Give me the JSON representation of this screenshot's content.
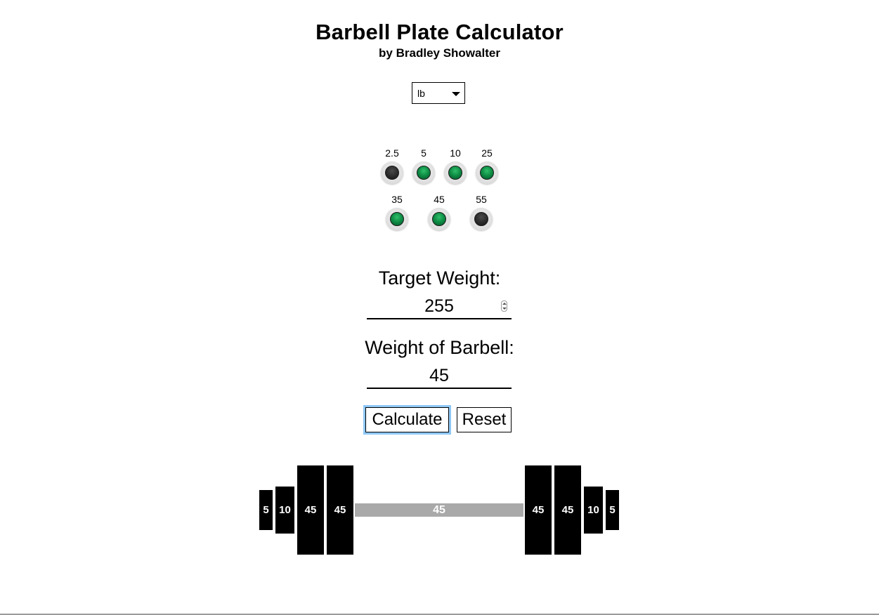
{
  "header": {
    "title": "Barbell Plate Calculator",
    "subtitle": "by Bradley Showalter"
  },
  "unit_select": {
    "selected": "lb"
  },
  "plate_toggles": [
    {
      "label": "2.5",
      "enabled": false
    },
    {
      "label": "5",
      "enabled": true
    },
    {
      "label": "10",
      "enabled": true
    },
    {
      "label": "25",
      "enabled": true
    },
    {
      "label": "35",
      "enabled": true
    },
    {
      "label": "45",
      "enabled": true
    },
    {
      "label": "55",
      "enabled": false
    }
  ],
  "form": {
    "target_label": "Target Weight:",
    "target_value": "255",
    "barbell_label": "Weight of Barbell:",
    "barbell_value": "45",
    "calculate_label": "Calculate",
    "reset_label": "Reset"
  },
  "result": {
    "bar_weight": "45",
    "left_plates": [
      "5",
      "10",
      "45",
      "45"
    ],
    "right_plates": [
      "45",
      "45",
      "10",
      "5"
    ]
  },
  "colors": {
    "led_on": "#0d8a43",
    "led_off": "#2b2b2b",
    "bar": "#a9a9a9",
    "plate": "#000000",
    "focus_ring": "#8ec8f6"
  }
}
